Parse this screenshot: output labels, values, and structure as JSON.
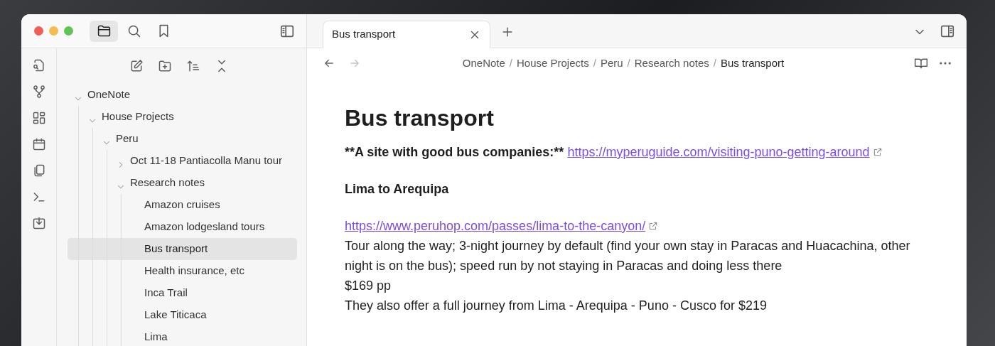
{
  "sidebar_tabs": [
    {
      "kind": "files",
      "selected": true
    },
    {
      "kind": "search",
      "selected": false
    },
    {
      "kind": "bookmarks",
      "selected": false
    }
  ],
  "tree": [
    {
      "label": "OneNote",
      "kind": "folder",
      "expanded": true,
      "selected": false,
      "children": [
        {
          "label": "House Projects",
          "kind": "folder",
          "expanded": true,
          "selected": false,
          "children": [
            {
              "label": "Peru",
              "kind": "folder",
              "expanded": true,
              "selected": false,
              "children": [
                {
                  "label": "Oct 11-18 Pantiacolla Manu tour",
                  "kind": "folder",
                  "expanded": false,
                  "selected": false
                },
                {
                  "label": "Research notes",
                  "kind": "folder",
                  "expanded": true,
                  "selected": false,
                  "children": [
                    {
                      "label": "Amazon cruises",
                      "kind": "note",
                      "selected": false
                    },
                    {
                      "label": "Amazon lodgesland tours",
                      "kind": "note",
                      "selected": false
                    },
                    {
                      "label": "Bus transport",
                      "kind": "note",
                      "selected": true
                    },
                    {
                      "label": "Health insurance, etc",
                      "kind": "note",
                      "selected": false
                    },
                    {
                      "label": "Inca Trail",
                      "kind": "note",
                      "selected": false
                    },
                    {
                      "label": "Lake Titicaca",
                      "kind": "note",
                      "selected": false
                    },
                    {
                      "label": "Lima",
                      "kind": "note",
                      "selected": false
                    }
                  ]
                }
              ]
            }
          ]
        }
      ]
    }
  ],
  "tabs": [
    {
      "label": "Bus transport",
      "selected": true
    }
  ],
  "nav": {
    "back_disabled": false,
    "forward_disabled": true
  },
  "breadcrumb": {
    "separator": "/",
    "items": [
      "OneNote",
      "House Projects",
      "Peru",
      "Research notes",
      "Bus transport"
    ]
  },
  "note": {
    "title": "Bus transport",
    "blocks": [
      {
        "kind": "lead",
        "text": "**A site with good bus companies:**",
        "link": "https://myperuguide.com/visiting-puno-getting-around"
      },
      {
        "kind": "subheading",
        "text": "Lima to Arequipa"
      },
      {
        "kind": "link",
        "link": "https://www.peruhop.com/passes/lima-to-the-canyon/"
      },
      {
        "kind": "text",
        "text": "Tour along the way; 3-night journey by default (find your own stay in Paracas and Huacachina, other night is on the bus); speed run by not staying in Paracas and doing less there"
      },
      {
        "kind": "text",
        "text": "$169 pp"
      },
      {
        "kind": "text",
        "text": "They also offer a full journey from Lima - Arequipa - Puno - Cusco for $219"
      }
    ]
  }
}
